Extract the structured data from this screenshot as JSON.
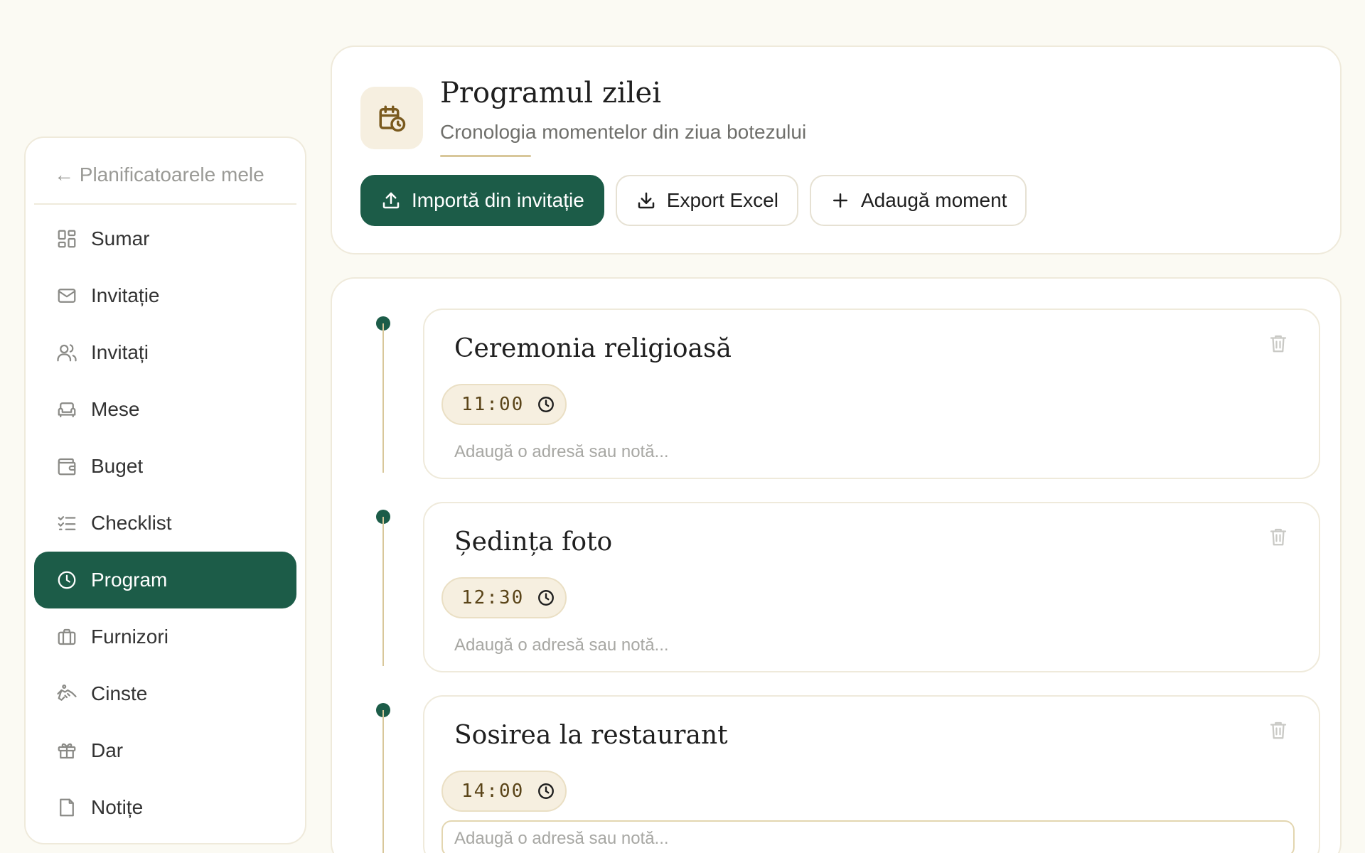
{
  "sidebar": {
    "back_label": "← Planificatoarele mele",
    "items": [
      {
        "label": "Sumar",
        "icon": "grid-icon"
      },
      {
        "label": "Invitație",
        "icon": "mail-icon"
      },
      {
        "label": "Invitați",
        "icon": "users-icon"
      },
      {
        "label": "Mese",
        "icon": "sofa-icon"
      },
      {
        "label": "Buget",
        "icon": "wallet-icon"
      },
      {
        "label": "Checklist",
        "icon": "checklist-icon"
      },
      {
        "label": "Program",
        "icon": "clock-icon",
        "active": true
      },
      {
        "label": "Furnizori",
        "icon": "briefcase-icon"
      },
      {
        "label": "Cinste",
        "icon": "handshake-icon"
      },
      {
        "label": "Dar",
        "icon": "gift-icon"
      },
      {
        "label": "Notițe",
        "icon": "note-icon"
      }
    ]
  },
  "header": {
    "title": "Programul zilei",
    "subtitle": "Cronologia momentelor din ziua botezului",
    "buttons": {
      "import": "Importă din invitație",
      "export": "Export Excel",
      "add": "Adaugă moment"
    }
  },
  "timeline": {
    "note_placeholder": "Adaugă o adresă sau notă...",
    "events": [
      {
        "title": "Ceremonia religioasă",
        "time": "11:00"
      },
      {
        "title": "Ședința foto",
        "time": "12:30"
      },
      {
        "title": "Sosirea la restaurant",
        "time": "14:00"
      }
    ]
  },
  "colors": {
    "accent": "#1c5c48",
    "timeline_line": "#d8c79a",
    "pill_bg": "#f6efe0"
  }
}
